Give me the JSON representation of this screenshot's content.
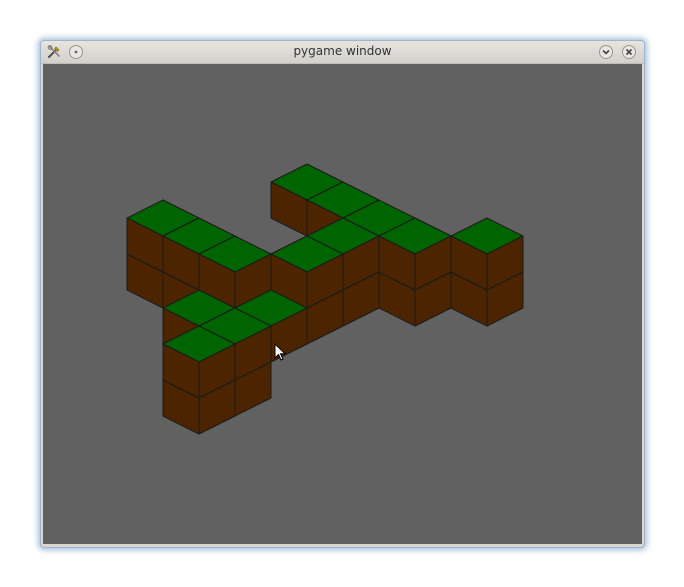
{
  "window": {
    "title": "pygame window",
    "buttons": {
      "app_menu_icon": "tools-icon",
      "pin_icon": "pin-icon",
      "minimize_icon": "chevron-down-icon",
      "close_icon": "close-icon"
    }
  },
  "scene": {
    "background_color": "#616161",
    "grass_color": "#006400",
    "dirt_color": "#4d2400",
    "outline_color": "#1a1a1a",
    "blocks": [
      {
        "x": 0,
        "y": 4,
        "z": 0
      },
      {
        "x": 1,
        "y": 4,
        "z": 0
      },
      {
        "x": 2,
        "y": 4,
        "z": 0
      },
      {
        "x": 3,
        "y": 4,
        "z": 0
      },
      {
        "x": 2,
        "y": 3,
        "z": 0
      },
      {
        "x": 3,
        "y": 3,
        "z": 0
      },
      {
        "x": 2,
        "y": 2,
        "z": 0
      },
      {
        "x": 3,
        "y": 2,
        "z": 0
      },
      {
        "x": 3,
        "y": 1,
        "z": 0
      },
      {
        "x": 4,
        "y": 1,
        "z": 0
      },
      {
        "x": 3,
        "y": 0,
        "z": 0
      },
      {
        "x": 4,
        "y": 0,
        "z": 0
      },
      {
        "x": 5,
        "y": 0,
        "z": 0
      },
      {
        "x": 2,
        "y": 5,
        "z": 0
      },
      {
        "x": 3,
        "y": 5,
        "z": 0
      },
      {
        "x": 3,
        "y": 6,
        "z": 0
      },
      {
        "x": 2,
        "y": 5,
        "z": -1
      },
      {
        "x": 3,
        "y": 5,
        "z": -1
      },
      {
        "x": 3,
        "y": 6,
        "z": -1
      },
      {
        "x": 0,
        "y": 4,
        "z": 1
      },
      {
        "x": 1,
        "y": 4,
        "z": 1
      },
      {
        "x": 2,
        "y": 4,
        "z": 1
      },
      {
        "x": 1,
        "y": 1,
        "z": 1
      },
      {
        "x": 2,
        "y": 1,
        "z": 1
      },
      {
        "x": 3,
        "y": 1,
        "z": 1
      },
      {
        "x": 3,
        "y": 2,
        "z": 1
      },
      {
        "x": 3,
        "y": 3,
        "z": 1
      },
      {
        "x": 4,
        "y": 1,
        "z": 1
      },
      {
        "x": 5,
        "y": 0,
        "z": 1
      }
    ],
    "cursor_icon": "mouse-pointer-icon"
  }
}
